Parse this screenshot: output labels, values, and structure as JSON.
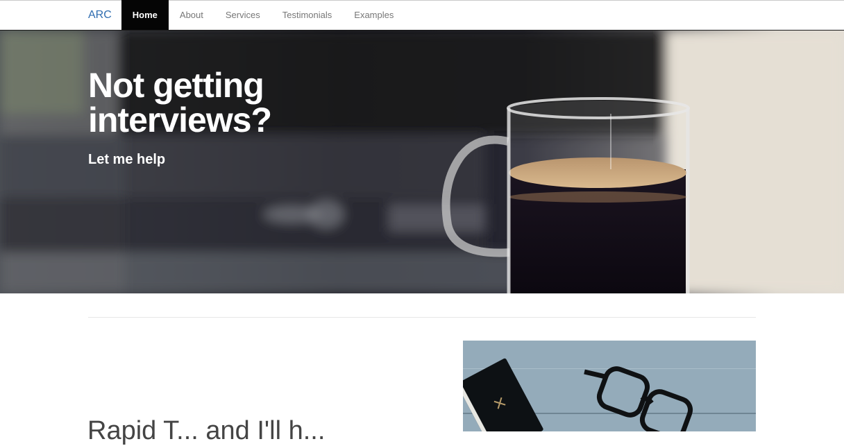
{
  "nav": {
    "brand": "ARC",
    "items": [
      {
        "label": "Home",
        "active": true
      },
      {
        "label": "About",
        "active": false
      },
      {
        "label": "Services",
        "active": false
      },
      {
        "label": "Testimonials",
        "active": false
      },
      {
        "label": "Examples",
        "active": false
      }
    ]
  },
  "hero": {
    "title": "Not getting interviews?",
    "subtitle": "Let me help"
  },
  "section": {
    "heading": "Rapid T... and I'll h..."
  },
  "colors": {
    "brand": "#2f6db0",
    "nav_active_bg": "#050505"
  },
  "icons": [
    "coffee-mug-photo",
    "notebook-glasses-photo"
  ]
}
